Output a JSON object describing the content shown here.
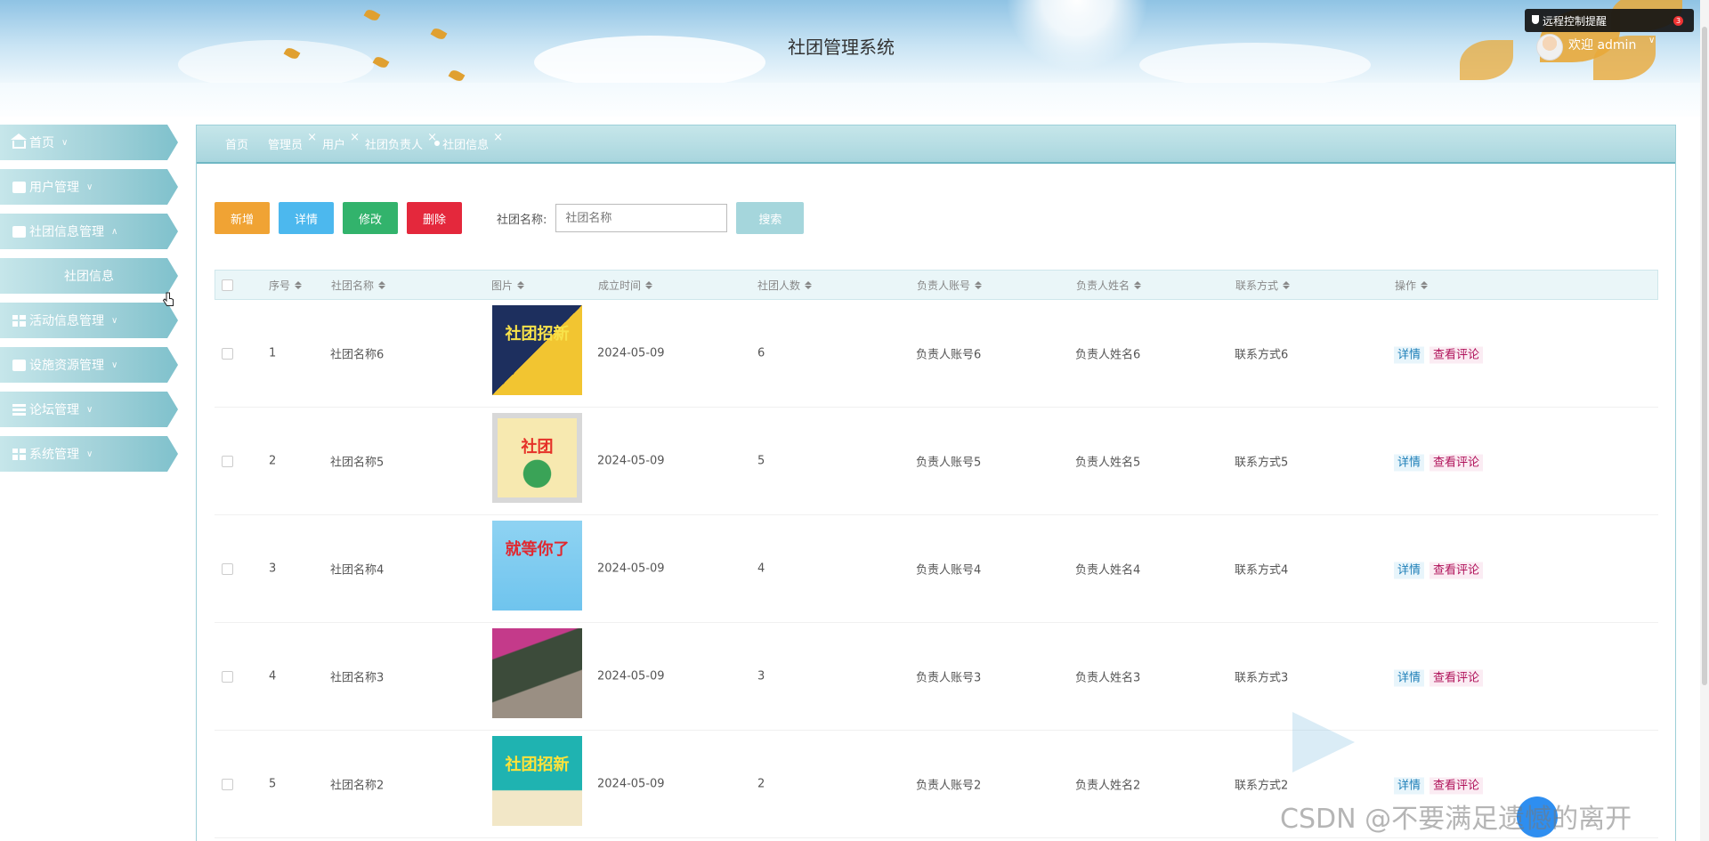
{
  "app": {
    "title": "社团管理系统",
    "remote_notice": "远程控制提醒",
    "remote_count": "3",
    "welcome": "欢迎 admin"
  },
  "sidebar": {
    "items": [
      {
        "label": "首页",
        "icon": "home-icon",
        "caret": "∨"
      },
      {
        "label": "用户管理",
        "icon": "doc-icon",
        "caret": "∨"
      },
      {
        "label": "社团信息管理",
        "icon": "doc-icon",
        "caret": "∧"
      },
      {
        "label": "社团信息",
        "icon": "",
        "caret": ""
      },
      {
        "label": "活动信息管理",
        "icon": "grid-icon",
        "caret": "∨"
      },
      {
        "label": "设施资源管理",
        "icon": "doc-icon",
        "caret": "∨"
      },
      {
        "label": "论坛管理",
        "icon": "list-icon",
        "caret": "∨"
      },
      {
        "label": "系统管理",
        "icon": "grid-icon",
        "caret": "∨"
      }
    ]
  },
  "tabs": [
    {
      "label": "首页",
      "closable": false
    },
    {
      "label": "管理员",
      "closable": true
    },
    {
      "label": "用户",
      "closable": true
    },
    {
      "label": "社团负责人",
      "closable": true
    },
    {
      "label": "社团信息",
      "closable": true,
      "active": true
    }
  ],
  "toolbar": {
    "add": "新增",
    "detail": "详情",
    "edit": "修改",
    "delete": "删除",
    "search_label": "社团名称:",
    "search_placeholder": "社团名称",
    "search_button": "搜索"
  },
  "table": {
    "headers": [
      "序号",
      "社团名称",
      "图片",
      "成立时间",
      "社团人数",
      "负责人账号",
      "负责人姓名",
      "联系方式",
      "操作"
    ],
    "rows": [
      {
        "no": "1",
        "name": "社团名称6",
        "date": "2024-05-09",
        "count": "6",
        "account": "负责人账号6",
        "person": "负责人姓名6",
        "contact": "联系方式6",
        "img_text": "社团招新"
      },
      {
        "no": "2",
        "name": "社团名称5",
        "date": "2024-05-09",
        "count": "5",
        "account": "负责人账号5",
        "person": "负责人姓名5",
        "contact": "联系方式5",
        "img_text": "社团"
      },
      {
        "no": "3",
        "name": "社团名称4",
        "date": "2024-05-09",
        "count": "4",
        "account": "负责人账号4",
        "person": "负责人姓名4",
        "contact": "联系方式4",
        "img_text": "就等你了"
      },
      {
        "no": "4",
        "name": "社团名称3",
        "date": "2024-05-09",
        "count": "3",
        "account": "负责人账号3",
        "person": "负责人姓名3",
        "contact": "联系方式3",
        "img_text": ""
      },
      {
        "no": "5",
        "name": "社团名称2",
        "date": "2024-05-09",
        "count": "2",
        "account": "负责人账号2",
        "person": "负责人姓名2",
        "contact": "联系方式2",
        "img_text": "社团招新"
      }
    ],
    "op_detail": "详情",
    "op_comment": "查看评论"
  },
  "watermark": "CSDN @不要满足遗憾的离开"
}
